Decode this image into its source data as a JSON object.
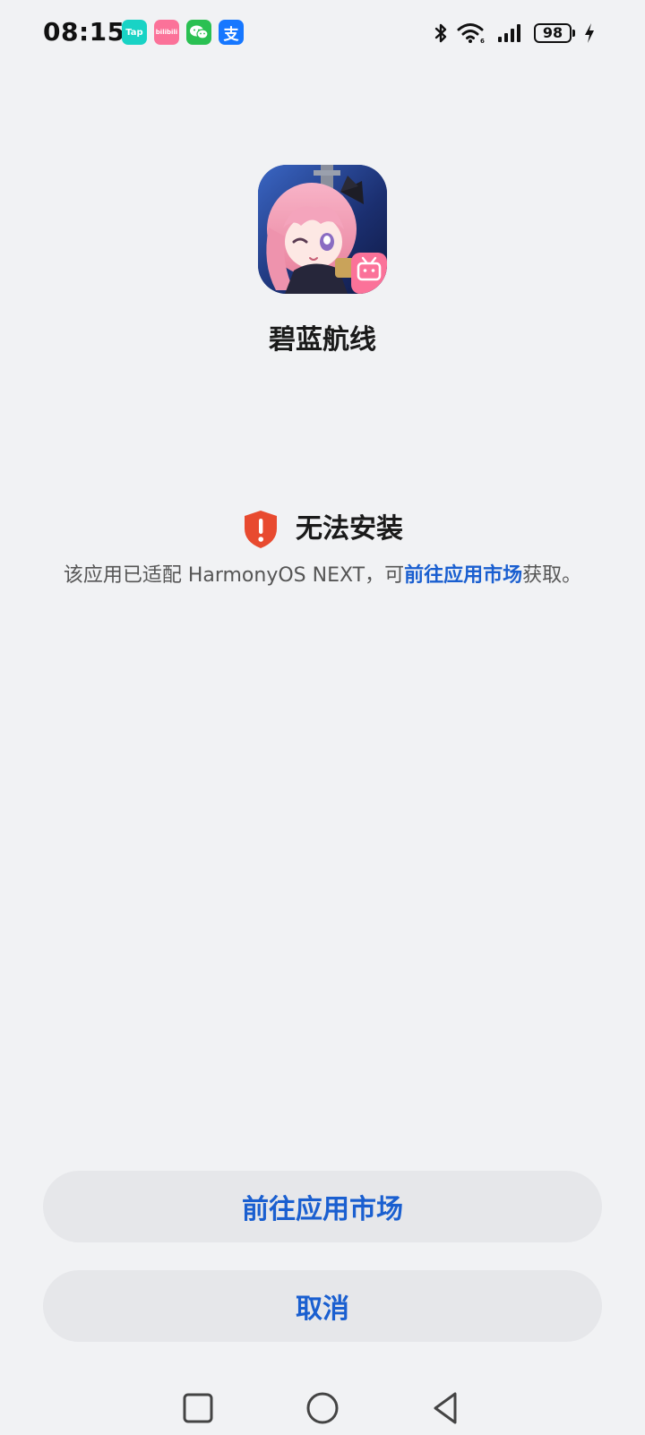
{
  "status_bar": {
    "time": "08:15",
    "notifications": [
      {
        "name": "taptap-notification-icon",
        "label": "Tap"
      },
      {
        "name": "bilibili-notification-icon",
        "label": "bilibili"
      },
      {
        "name": "wechat-notification-icon",
        "label": ""
      },
      {
        "name": "alipay-notification-icon",
        "label": "支"
      }
    ],
    "battery_level": "98"
  },
  "app": {
    "name": "碧蓝航线",
    "icon": "azur-lane-app-icon",
    "badge_icon": "bilibili-tv-icon"
  },
  "warning": {
    "icon": "shield-exclamation-icon",
    "title": "无法安装",
    "desc_prefix": "该应用已适配 HarmonyOS NEXT，可",
    "desc_link": "前往应用市场",
    "desc_suffix": "获取。"
  },
  "buttons": {
    "market": "前往应用市场",
    "cancel": "取消"
  },
  "colors": {
    "background": "#f1f2f4",
    "accent": "#1a5fd0",
    "warning": "#e84a2f",
    "button_bg": "#e6e7ea"
  }
}
